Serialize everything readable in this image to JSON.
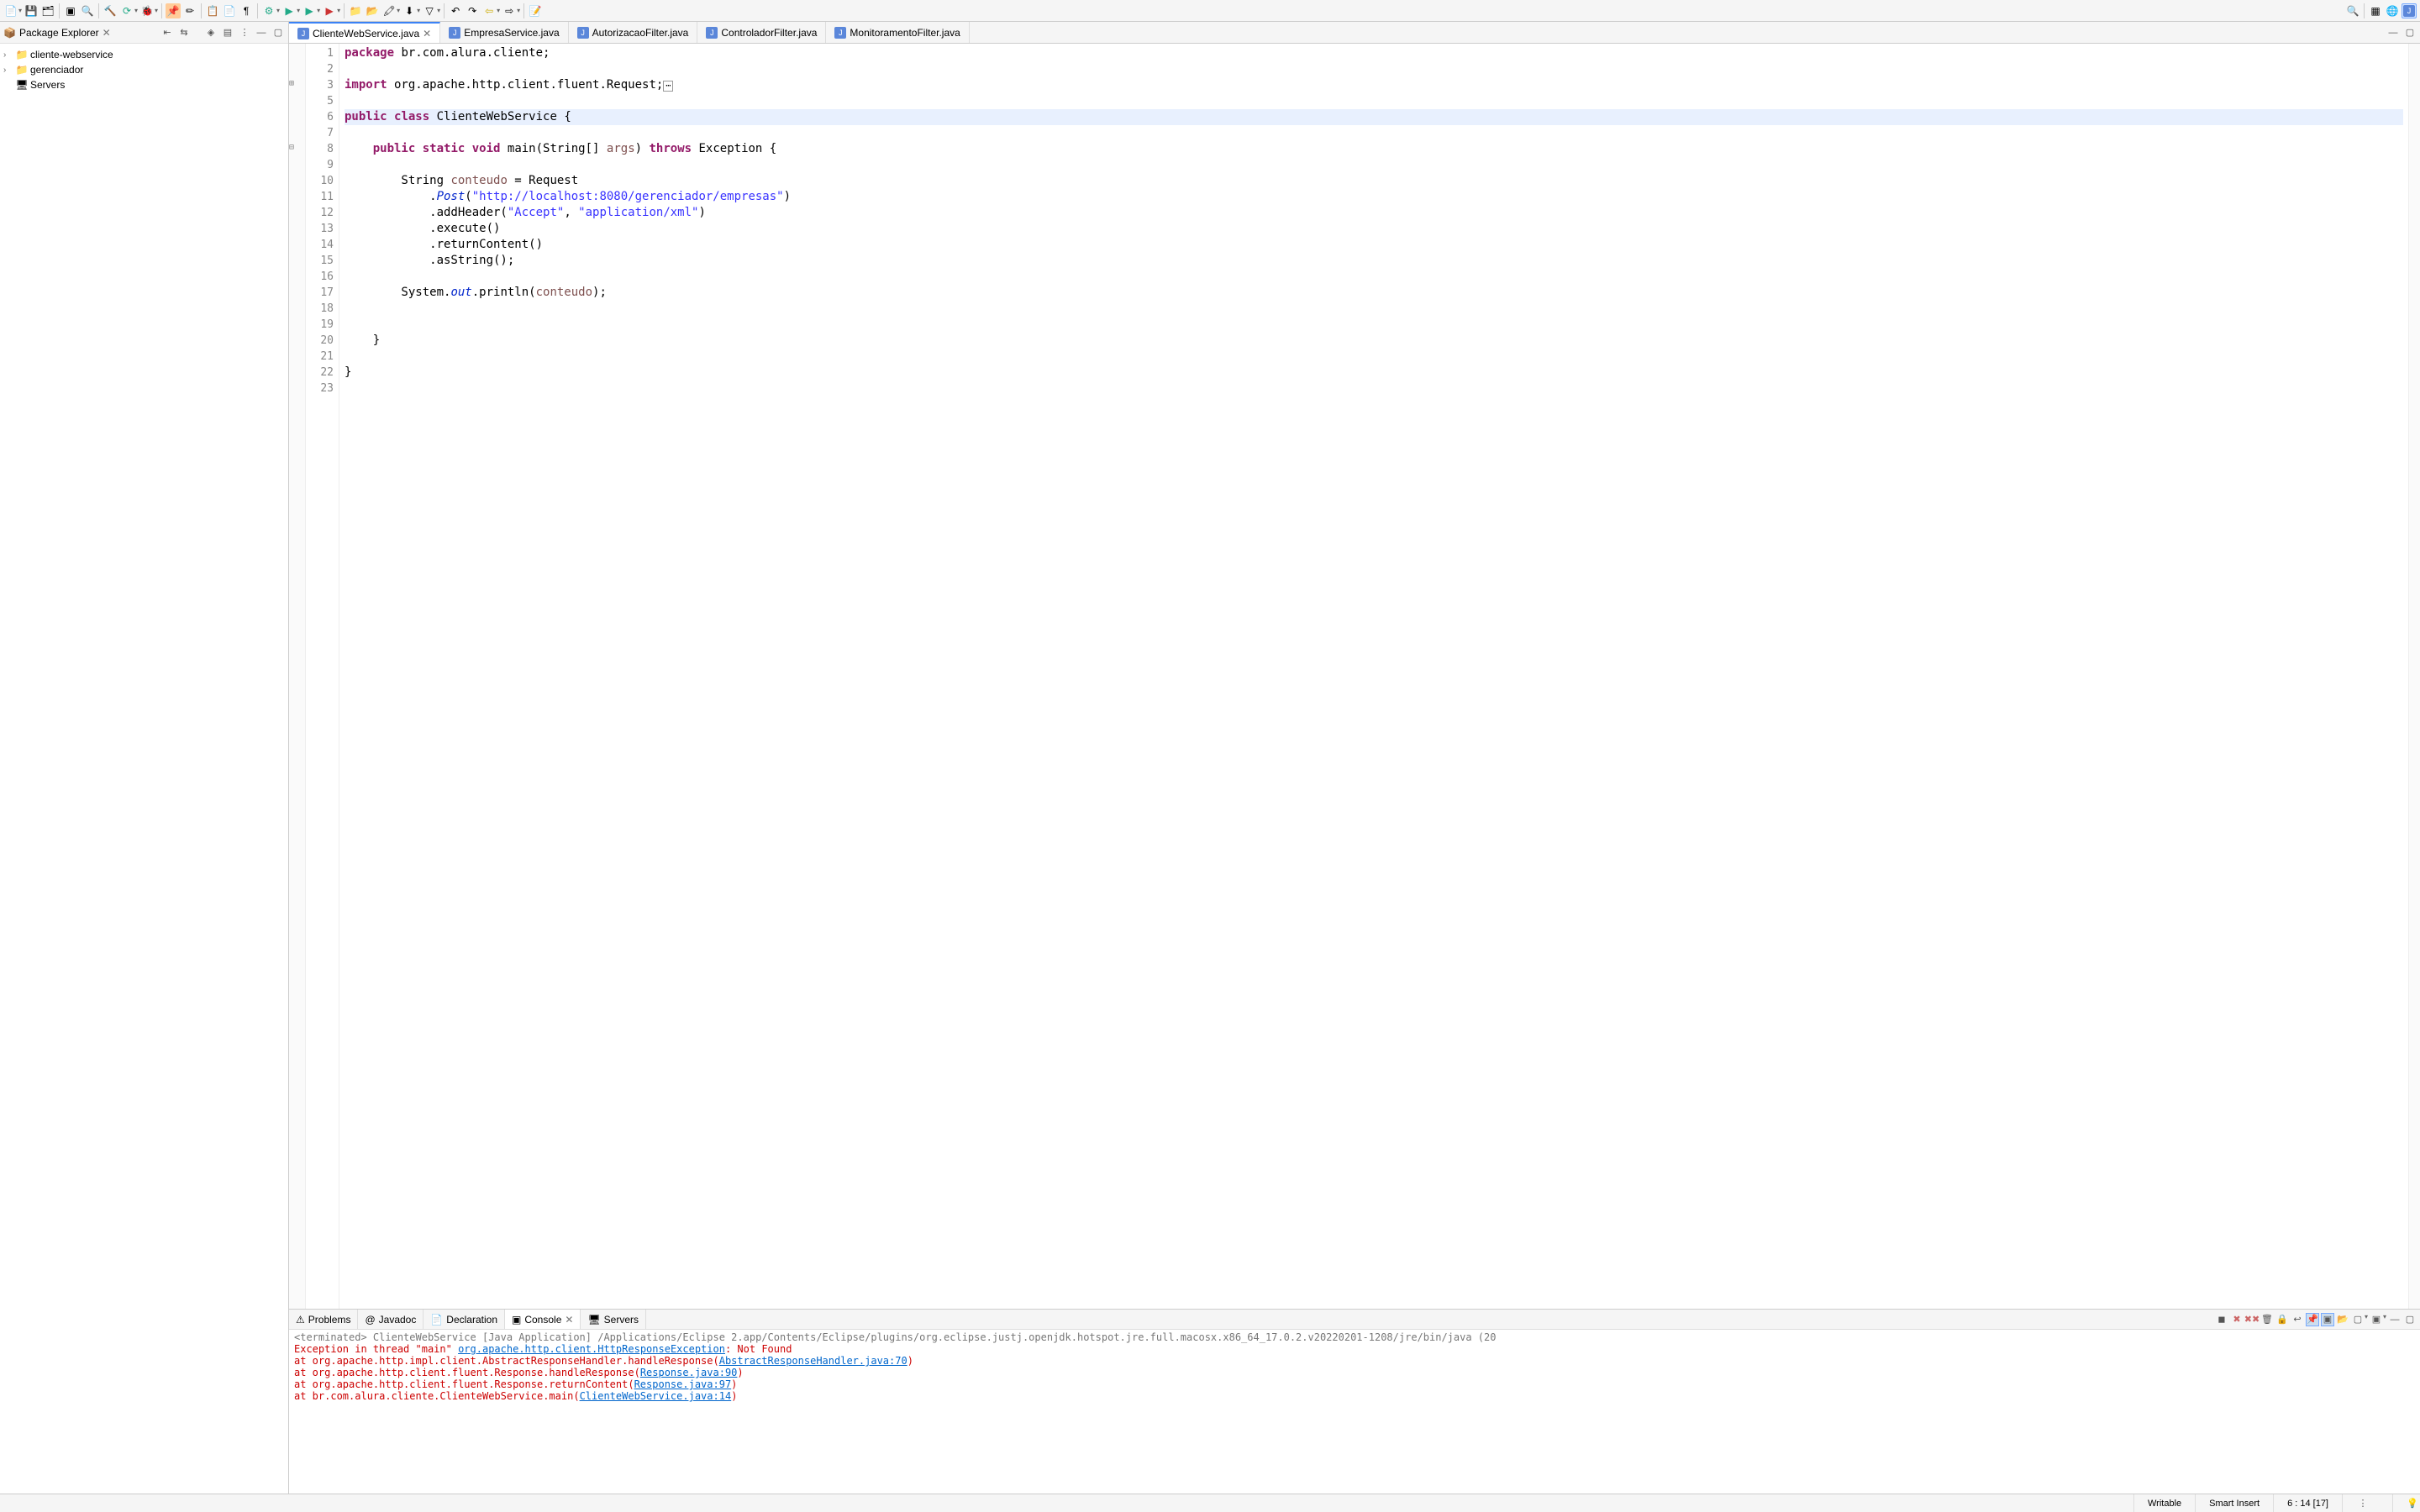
{
  "toolbar": {
    "search_icon": "🔍"
  },
  "sidebar": {
    "title": "Package Explorer",
    "items": [
      {
        "label": "cliente-webservice",
        "icon": "📁",
        "expandable": true
      },
      {
        "label": "gerenciador",
        "icon": "📁",
        "expandable": true
      },
      {
        "label": "Servers",
        "icon": "🖥",
        "expandable": false
      }
    ]
  },
  "tabs": [
    {
      "label": "ClienteWebService.java",
      "active": true,
      "closable": true
    },
    {
      "label": "EmpresaService.java",
      "active": false,
      "closable": false
    },
    {
      "label": "AutorizacaoFilter.java",
      "active": false,
      "closable": false
    },
    {
      "label": "ControladorFilter.java",
      "active": false,
      "closable": false
    },
    {
      "label": "MonitoramentoFilter.java",
      "active": false,
      "closable": false
    }
  ],
  "code": {
    "lines": [
      {
        "n": 1,
        "tokens": [
          [
            "kw",
            "package"
          ],
          [
            "",
            " br.com.alura.cliente;"
          ]
        ]
      },
      {
        "n": 2,
        "tokens": []
      },
      {
        "n": 3,
        "tokens": [
          [
            "kw",
            "import"
          ],
          [
            "",
            " org.apache.http.client.fluent.Request;"
          ],
          [
            "box",
            "▫"
          ]
        ],
        "marker": "expand"
      },
      {
        "n": 5,
        "tokens": []
      },
      {
        "n": 6,
        "tokens": [
          [
            "kw",
            "public"
          ],
          [
            "",
            " "
          ],
          [
            "kw",
            "class"
          ],
          [
            "",
            " "
          ],
          [
            "cls",
            "ClienteWebService"
          ],
          [
            "",
            " {"
          ]
        ],
        "highlight": true
      },
      {
        "n": 7,
        "tokens": []
      },
      {
        "n": 8,
        "tokens": [
          [
            "",
            "    "
          ],
          [
            "kw",
            "public"
          ],
          [
            "",
            " "
          ],
          [
            "kw",
            "static"
          ],
          [
            "",
            " "
          ],
          [
            "kw",
            "void"
          ],
          [
            "",
            " main(String[] "
          ],
          [
            "var",
            "args"
          ],
          [
            "",
            ") "
          ],
          [
            "kw",
            "throws"
          ],
          [
            "",
            " Exception {"
          ]
        ],
        "marker": "fold"
      },
      {
        "n": 9,
        "tokens": []
      },
      {
        "n": 10,
        "tokens": [
          [
            "",
            "        String "
          ],
          [
            "var",
            "conteudo"
          ],
          [
            "",
            " = Request"
          ]
        ]
      },
      {
        "n": 11,
        "tokens": [
          [
            "",
            "            ."
          ],
          [
            "fld",
            "Post"
          ],
          [
            "",
            "("
          ],
          [
            "str",
            "\"http://localhost:8080/gerenciador/empresas\""
          ],
          [
            "",
            ")"
          ]
        ]
      },
      {
        "n": 12,
        "tokens": [
          [
            "",
            "            .addHeader("
          ],
          [
            "str",
            "\"Accept\""
          ],
          [
            "",
            ", "
          ],
          [
            "str",
            "\"application/xml\""
          ],
          [
            "",
            ")"
          ]
        ]
      },
      {
        "n": 13,
        "tokens": [
          [
            "",
            "            .execute()"
          ]
        ]
      },
      {
        "n": 14,
        "tokens": [
          [
            "",
            "            .returnContent()"
          ]
        ]
      },
      {
        "n": 15,
        "tokens": [
          [
            "",
            "            .asString();"
          ]
        ]
      },
      {
        "n": 16,
        "tokens": []
      },
      {
        "n": 17,
        "tokens": [
          [
            "",
            "        System."
          ],
          [
            "fld",
            "out"
          ],
          [
            "",
            ".println("
          ],
          [
            "var",
            "conteudo"
          ],
          [
            "",
            ");"
          ]
        ]
      },
      {
        "n": 18,
        "tokens": []
      },
      {
        "n": 19,
        "tokens": []
      },
      {
        "n": 20,
        "tokens": [
          [
            "",
            "    }"
          ]
        ]
      },
      {
        "n": 21,
        "tokens": []
      },
      {
        "n": 22,
        "tokens": [
          [
            "",
            "}"
          ]
        ]
      },
      {
        "n": 23,
        "tokens": []
      }
    ]
  },
  "bottom_tabs": [
    {
      "label": "Problems",
      "icon": "⚠"
    },
    {
      "label": "Javadoc",
      "icon": "@"
    },
    {
      "label": "Declaration",
      "icon": "📄"
    },
    {
      "label": "Console",
      "icon": "▣",
      "active": true,
      "closable": true
    },
    {
      "label": "Servers",
      "icon": "🖥"
    }
  ],
  "console": {
    "header": "<terminated> ClienteWebService [Java Application] /Applications/Eclipse 2.app/Contents/Eclipse/plugins/org.eclipse.justj.openjdk.hotspot.jre.full.macosx.x86_64_17.0.2.v20220201-1208/jre/bin/java  (20",
    "lines": [
      {
        "parts": [
          [
            "err",
            "Exception in thread \"main\" "
          ],
          [
            "link",
            "org.apache.http.client.HttpResponseException"
          ],
          [
            "err",
            ": Not Found"
          ]
        ]
      },
      {
        "parts": [
          [
            "err",
            "        at org.apache.http.impl.client.AbstractResponseHandler.handleResponse("
          ],
          [
            "link",
            "AbstractResponseHandler.java:70"
          ],
          [
            "err",
            ")"
          ]
        ]
      },
      {
        "parts": [
          [
            "err",
            "        at org.apache.http.client.fluent.Response.handleResponse("
          ],
          [
            "link",
            "Response.java:90"
          ],
          [
            "err",
            ")"
          ]
        ]
      },
      {
        "parts": [
          [
            "err",
            "        at org.apache.http.client.fluent.Response.returnContent("
          ],
          [
            "link",
            "Response.java:97"
          ],
          [
            "err",
            ")"
          ]
        ]
      },
      {
        "parts": [
          [
            "err",
            "        at br.com.alura.cliente.ClienteWebService.main("
          ],
          [
            "link",
            "ClienteWebService.java:14"
          ],
          [
            "err",
            ")"
          ]
        ]
      }
    ]
  },
  "status": {
    "writable": "Writable",
    "insert": "Smart Insert",
    "pos": "6 : 14 [17]"
  }
}
